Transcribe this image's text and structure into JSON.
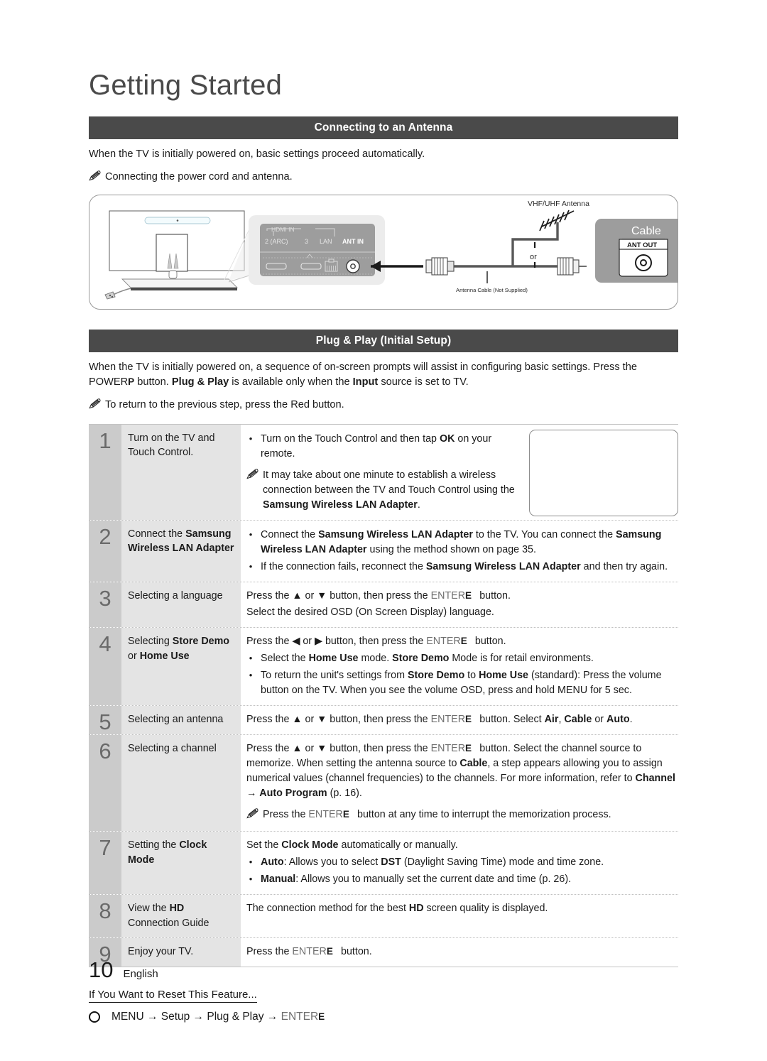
{
  "page": {
    "title": "Getting Started",
    "footer_number": "10",
    "footer_language": "English"
  },
  "antenna_section": {
    "header": "Connecting to an Antenna",
    "intro": "When the TV is initially powered on, basic settings proceed automatically.",
    "note": "Connecting the power cord and antenna.",
    "note_icon": "pencil-note-icon",
    "diagram": {
      "panel_group_label": "HDMI IN",
      "ports": [
        "2 (ARC)",
        "3",
        "LAN",
        "ANT IN"
      ],
      "antenna_label": "VHF/UHF Antenna",
      "or_label": "or",
      "cable_caption": "Antenna Cable (Not Supplied)",
      "cable_box_title": "Cable",
      "ant_out_label": "ANT OUT"
    }
  },
  "plugplay_section": {
    "header": "Plug & Play (Initial Setup)",
    "intro_part1": "When the TV is initially powered on, a sequence of on-screen prompts will assist in configuring basic settings. Press the ",
    "intro_power": "POWER",
    "intro_power_glyph": "P",
    "intro_part2": " button. ",
    "intro_bold_plugplay": "Plug & Play",
    "intro_part3": " is available only when the ",
    "intro_bold_input": "Input",
    "intro_part4": " source is set to TV.",
    "note": "To return to the previous step, press the Red button.",
    "steps": [
      {
        "number": "1",
        "label": "Turn on the TV and Touch Control.",
        "has_image": true,
        "lines": [
          {
            "kind": "bullet",
            "text": "Turn on the Touch Control and then tap OK on your remote."
          },
          {
            "kind": "note",
            "text": "It may take about one minute to establish a wireless connection between the TV and Touch Control using the Samsung Wireless LAN Adapter."
          }
        ]
      },
      {
        "number": "2",
        "label": "Connect the Samsung Wireless LAN Adapter",
        "has_image": false,
        "lines": [
          {
            "kind": "bullet",
            "text": "Connect the Samsung Wireless LAN Adapter to the TV. You can connect the Samsung Wireless LAN Adapter using the method shown on page 35."
          },
          {
            "kind": "bullet",
            "text": "If the connection fails, reconnect the Samsung Wireless LAN Adapter and then try again."
          }
        ]
      },
      {
        "number": "3",
        "label": "Selecting a language",
        "has_image": false,
        "lines": [
          {
            "kind": "plain-enter-ud",
            "text": "Press the ▲ or ▼ button, then press the ENTERE button."
          },
          {
            "kind": "plain",
            "text": "Select the desired OSD (On Screen Display) language."
          }
        ]
      },
      {
        "number": "4",
        "label": "Selecting Store Demo or Home Use",
        "has_image": false,
        "lines": [
          {
            "kind": "plain-enter-lr",
            "text": "Press the ◀ or ▶ button, then press the ENTERE button."
          },
          {
            "kind": "bullet",
            "text": "Select the Home Use mode. Store Demo Mode is for retail environments."
          },
          {
            "kind": "bullet",
            "text": "To return the unit's settings from Store Demo to Home Use (standard): Press the volume button on the TV. When you see the volume OSD, press and hold MENU for 5 sec."
          }
        ]
      },
      {
        "number": "5",
        "label": "Selecting an antenna",
        "has_image": false,
        "lines": [
          {
            "kind": "plain-enter-ud",
            "text": "Press the ▲ or ▼ button, then press the ENTERE button. Select Air, Cable or Auto."
          }
        ]
      },
      {
        "number": "6",
        "label": "Selecting a channel",
        "has_image": false,
        "lines": [
          {
            "kind": "plain-enter-ud",
            "text": "Press the ▲ or ▼ button, then press the ENTERE button. Select the channel source to memorize. When setting the antenna source to Cable, a step appears allowing you to assign numerical values (channel frequencies) to the channels. For more information, refer to Channel → Auto Program (p. 16)."
          },
          {
            "kind": "note",
            "text": "Press the ENTERE button at any time to interrupt the memorization process."
          }
        ]
      },
      {
        "number": "7",
        "label": "Setting the Clock Mode",
        "has_image": false,
        "lines": [
          {
            "kind": "plain",
            "text": "Set the Clock Mode automatically or manually."
          },
          {
            "kind": "bullet",
            "text": "Auto: Allows you to select DST (Daylight Saving Time) mode and time zone."
          },
          {
            "kind": "bullet",
            "text": "Manual: Allows you to manually set the current date and time (p. 26)."
          }
        ]
      },
      {
        "number": "8",
        "label": "View the HD Connection Guide",
        "has_image": false,
        "lines": [
          {
            "kind": "plain",
            "text": "The connection method for the best HD screen quality is displayed."
          }
        ]
      },
      {
        "number": "9",
        "label": "Enjoy your TV.",
        "has_image": false,
        "lines": [
          {
            "kind": "plain-enter-plain",
            "text": "Press the ENTERE button."
          }
        ]
      }
    ]
  },
  "reset_section": {
    "title": "If You Want to Reset This Feature...",
    "bullet_icon": "circle-bullet-icon",
    "path": "MENU → Setup → Plug & Play → ENTERE"
  },
  "colors": {
    "header_bar": "#4a4a4a",
    "step_number_bg": "#cbcbcb",
    "step_label_bg": "#e4e4e4",
    "text": "#1a1a1a"
  }
}
